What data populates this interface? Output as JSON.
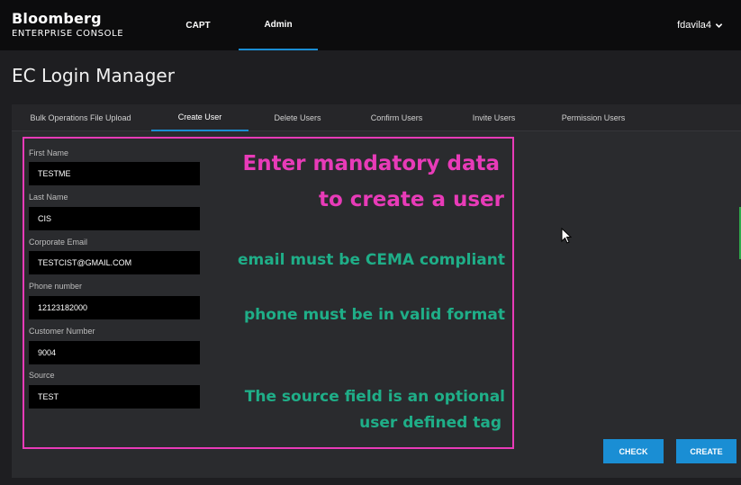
{
  "brand": {
    "name": "Bloomberg",
    "subtitle": "ENTERPRISE CONSOLE"
  },
  "nav": {
    "items": [
      {
        "label": "CAPT"
      },
      {
        "label": "Admin",
        "active": true
      }
    ]
  },
  "user": {
    "name": "fdavila4",
    "icon": "chevron-down-icon"
  },
  "page": {
    "title": "EC Login Manager"
  },
  "tabs": [
    {
      "label": "Bulk Operations File Upload"
    },
    {
      "label": "Create User",
      "active": true
    },
    {
      "label": "Delete Users"
    },
    {
      "label": "Confirm Users"
    },
    {
      "label": "Invite Users"
    },
    {
      "label": "Permission Users"
    }
  ],
  "form": {
    "fields": [
      {
        "label": "First Name",
        "value": "TESTME"
      },
      {
        "label": "Last Name",
        "value": "CIS"
      },
      {
        "label": "Corporate Email",
        "value": "TESTCIST@GMAIL.COM"
      },
      {
        "label": "Phone number",
        "value": "12123182000"
      },
      {
        "label": "Customer Number",
        "value": "9004"
      },
      {
        "label": "Source",
        "value": "TEST"
      }
    ]
  },
  "annotations": {
    "headline_line1": "Enter mandatory data",
    "headline_line2": "to create a user",
    "email_note": "email must be CEMA compliant",
    "phone_note": "phone must be in valid format",
    "source_note_line1": "The source field is an  optional",
    "source_note_line2": "user defined tag"
  },
  "buttons": {
    "check": "CHECK",
    "create": "CREATE"
  },
  "colors": {
    "accent": "#1a8ed4",
    "annotation_pink": "#e83bb8",
    "annotation_teal": "#1fae88"
  }
}
